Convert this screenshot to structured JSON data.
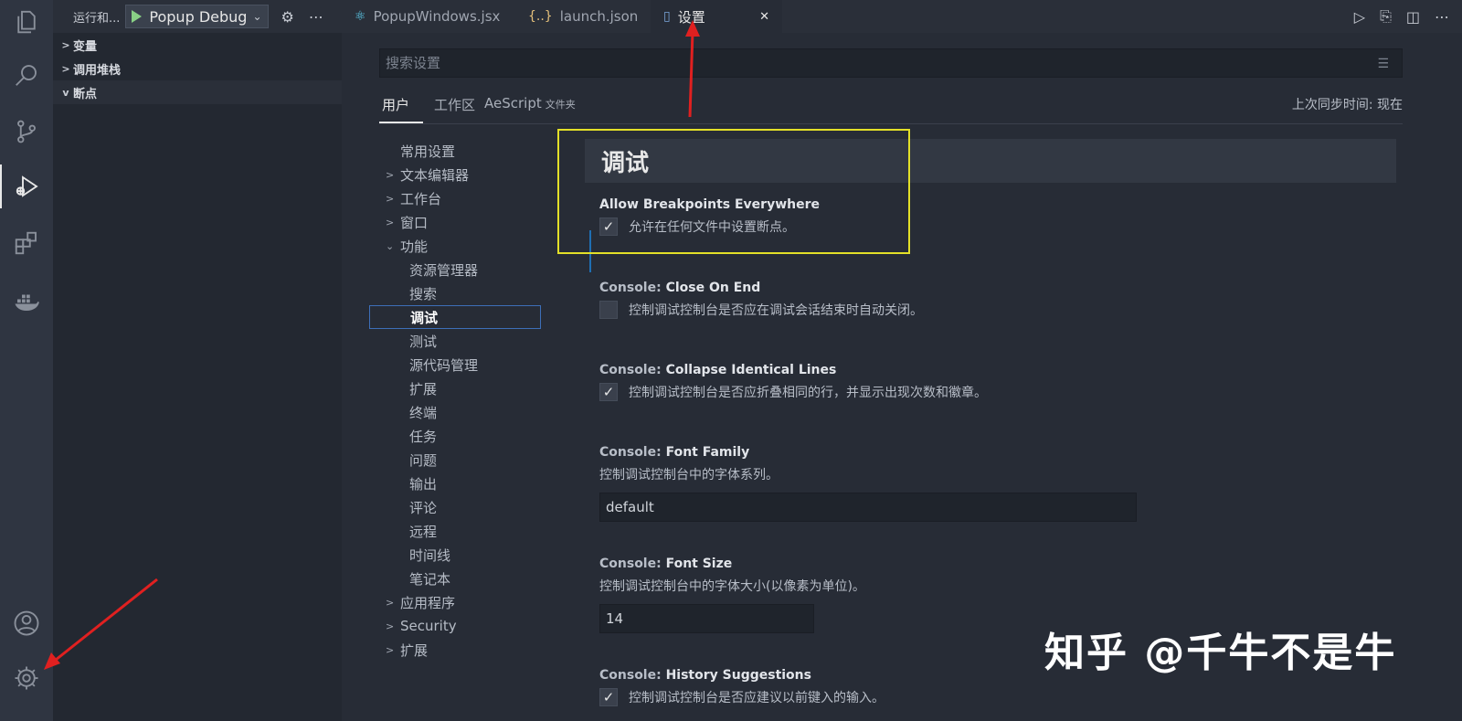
{
  "run_view": {
    "title": "运行和...",
    "config": "Popup Debug"
  },
  "sidebar": {
    "sections": [
      {
        "label": "变量",
        "expanded": false
      },
      {
        "label": "调用堆栈",
        "expanded": false
      },
      {
        "label": "断点",
        "expanded": true
      }
    ]
  },
  "tabs": [
    {
      "label": "PopupWindows.jsx",
      "icon": "react-icon",
      "active": false
    },
    {
      "label": "launch.json",
      "icon": "json-icon",
      "active": false
    },
    {
      "label": "设置",
      "icon": "file-icon",
      "active": true,
      "close": "✕"
    }
  ],
  "settings": {
    "search_placeholder": "搜索设置",
    "scopes": {
      "user": "用户",
      "workspace": "工作区",
      "folder": "AeScript",
      "folder_suffix": "文件夹"
    },
    "sync_text": "上次同步时间: 现在",
    "toc": [
      {
        "label": "常用设置",
        "level": 0,
        "arrow": ""
      },
      {
        "label": "文本编辑器",
        "level": 0,
        "arrow": ">"
      },
      {
        "label": "工作台",
        "level": 0,
        "arrow": ">"
      },
      {
        "label": "窗口",
        "level": 0,
        "arrow": ">"
      },
      {
        "label": "功能",
        "level": 0,
        "arrow": "v"
      },
      {
        "label": "资源管理器",
        "level": 1,
        "arrow": ""
      },
      {
        "label": "搜索",
        "level": 1,
        "arrow": ""
      },
      {
        "label": "调试",
        "level": 1,
        "arrow": "",
        "selected": true
      },
      {
        "label": "测试",
        "level": 1,
        "arrow": ""
      },
      {
        "label": "源代码管理",
        "level": 1,
        "arrow": ""
      },
      {
        "label": "扩展",
        "level": 1,
        "arrow": ""
      },
      {
        "label": "终端",
        "level": 1,
        "arrow": ""
      },
      {
        "label": "任务",
        "level": 1,
        "arrow": ""
      },
      {
        "label": "问题",
        "level": 1,
        "arrow": ""
      },
      {
        "label": "输出",
        "level": 1,
        "arrow": ""
      },
      {
        "label": "评论",
        "level": 1,
        "arrow": ""
      },
      {
        "label": "远程",
        "level": 1,
        "arrow": ""
      },
      {
        "label": "时间线",
        "level": 1,
        "arrow": ""
      },
      {
        "label": "笔记本",
        "level": 1,
        "arrow": ""
      },
      {
        "label": "应用程序",
        "level": 0,
        "arrow": ">"
      },
      {
        "label": "Security",
        "level": 0,
        "arrow": ">"
      },
      {
        "label": "扩展",
        "level": 0,
        "arrow": ">"
      }
    ],
    "category_header": "调试",
    "items": {
      "allow_breakpoints": {
        "title": "Allow Breakpoints Everywhere",
        "desc": "允许在任何文件中设置断点。",
        "checked": true
      },
      "close_on_end": {
        "cat": "Console: ",
        "title": "Close On End",
        "desc": "控制调试控制台是否应在调试会话结束时自动关闭。",
        "checked": false
      },
      "collapse_lines": {
        "cat": "Console: ",
        "title": "Collapse Identical Lines",
        "desc": "控制调试控制台是否应折叠相同的行，并显示出现次数和徽章。",
        "checked": true
      },
      "font_family": {
        "cat": "Console: ",
        "title": "Font Family",
        "desc": "控制调试控制台中的字体系列。",
        "value": "default"
      },
      "font_size": {
        "cat": "Console: ",
        "title": "Font Size",
        "desc": "控制调试控制台中的字体大小(以像素为单位)。",
        "value": "14"
      },
      "history": {
        "cat": "Console: ",
        "title": "History Suggestions",
        "desc": "控制调试控制台是否应建议以前键入的输入。",
        "checked": true
      }
    }
  },
  "check_mark": "✓",
  "watermark": "知乎 @千牛不是牛",
  "colors": {
    "highlight": "#e3e028",
    "arrow": "#e02020",
    "accent": "#3d6fb8"
  }
}
